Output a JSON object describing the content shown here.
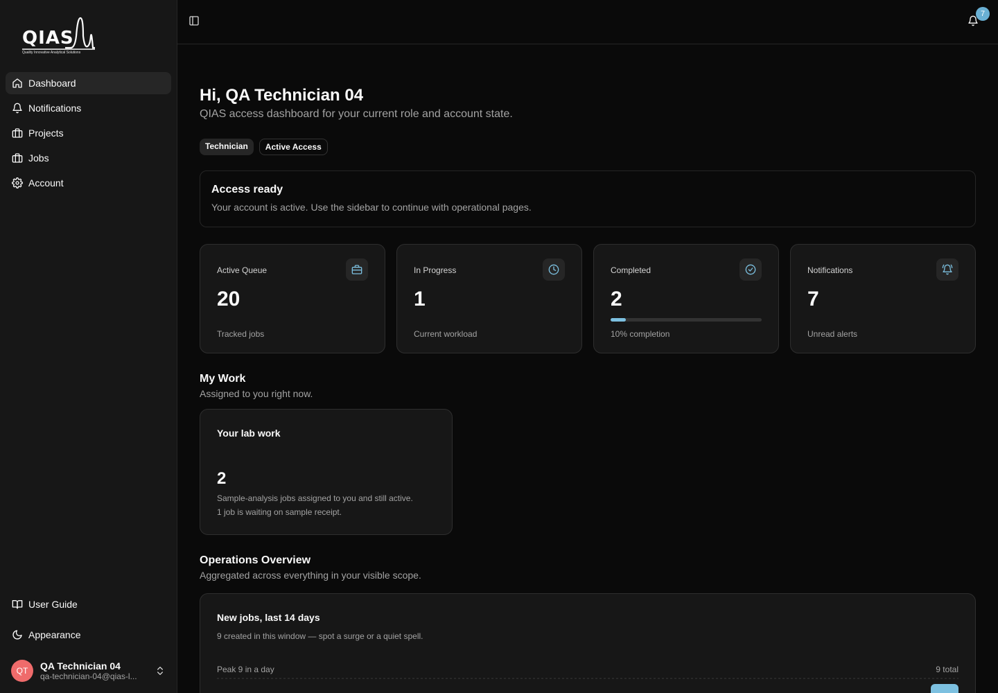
{
  "brand": {
    "name": "QIAS",
    "tagline": "Quality Innovative Analytical Solutions"
  },
  "sidebar": {
    "items": [
      {
        "label": "Dashboard",
        "icon": "home-icon",
        "active": true
      },
      {
        "label": "Notifications",
        "icon": "bell-icon",
        "active": false
      },
      {
        "label": "Projects",
        "icon": "briefcase-icon",
        "active": false
      },
      {
        "label": "Jobs",
        "icon": "briefcase-icon",
        "active": false
      },
      {
        "label": "Account",
        "icon": "gear-icon",
        "active": false
      }
    ],
    "bottom": [
      {
        "label": "User Guide",
        "icon": "book-icon"
      },
      {
        "label": "Appearance",
        "icon": "moon-icon"
      }
    ],
    "user": {
      "initials": "QT",
      "name": "QA Technician 04",
      "email": "qa-technician-04@qias-l..."
    }
  },
  "topbar": {
    "notification_count": "7"
  },
  "header": {
    "greeting": "Hi, QA Technician 04",
    "subtitle": "QIAS access dashboard for your current role and account state.",
    "badges": [
      "Technician",
      "Active Access"
    ]
  },
  "access": {
    "title": "Access ready",
    "text": "Your account is active. Use the sidebar to continue with operational pages."
  },
  "stats": [
    {
      "label": "Active Queue",
      "value": "20",
      "sub": "Tracked jobs",
      "icon": "briefcase-icon"
    },
    {
      "label": "In Progress",
      "value": "1",
      "sub": "Current workload",
      "icon": "clock-icon"
    },
    {
      "label": "Completed",
      "value": "2",
      "sub": "10% completion",
      "icon": "check-circle-icon",
      "progress": 0.1
    },
    {
      "label": "Notifications",
      "value": "7",
      "sub": "Unread alerts",
      "icon": "bell-ring-icon"
    }
  ],
  "my_work": {
    "title": "My Work",
    "subtitle": "Assigned to you right now.",
    "card": {
      "title": "Your lab work",
      "value": "2",
      "line1": "Sample-analysis jobs assigned to you and still active.",
      "line2": "1 job is waiting on sample receipt."
    }
  },
  "operations": {
    "title": "Operations Overview",
    "subtitle": "Aggregated across everything in your visible scope.",
    "chart": {
      "title": "New jobs, last 14 days",
      "subtitle": "9 created in this window — spot a surge or a quiet spell.",
      "peak": "Peak 9 in a day",
      "total": "9 total"
    }
  },
  "colors": {
    "accent": "#7cc0e0",
    "avatar": "#ef6b6b",
    "badge": "#6ab0d4"
  }
}
